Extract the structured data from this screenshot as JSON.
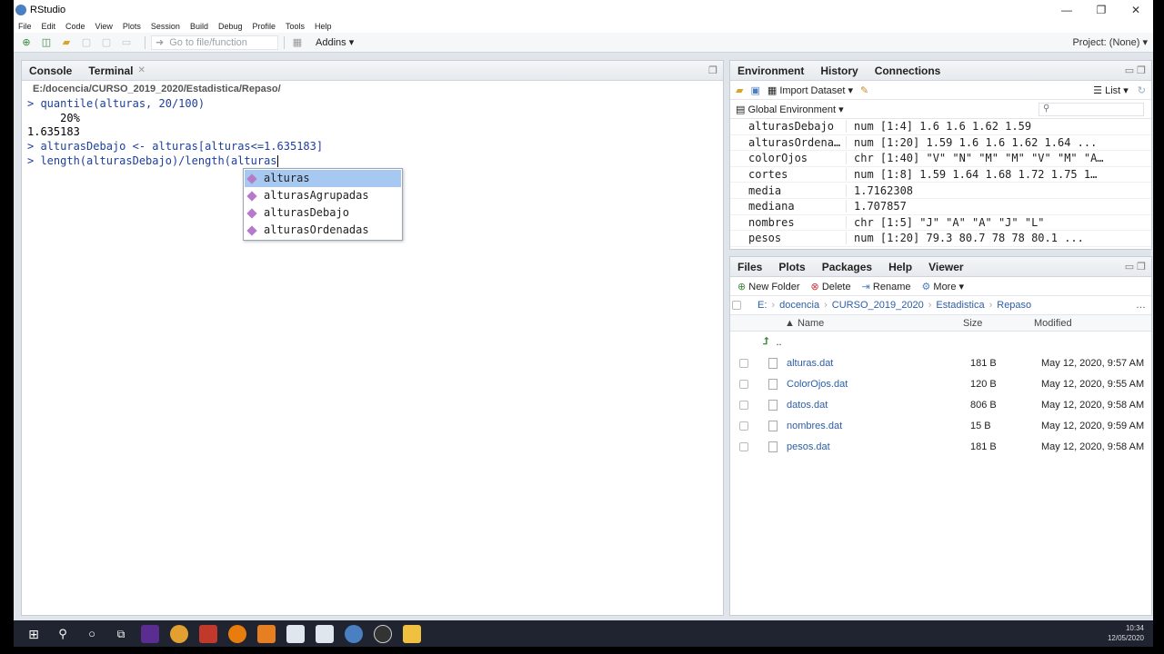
{
  "window": {
    "title": "RStudio",
    "controls": [
      "—",
      "❐",
      "✕"
    ]
  },
  "menu": [
    "File",
    "Edit",
    "Code",
    "View",
    "Plots",
    "Session",
    "Build",
    "Debug",
    "Profile",
    "Tools",
    "Help"
  ],
  "toolbar": {
    "goto_placeholder": "Go to file/function",
    "addins": "Addins",
    "project": "Project: (None)"
  },
  "console": {
    "tabs": [
      "Console",
      "Terminal"
    ],
    "path": "E:/docencia/CURSO_2019_2020/Estadistica/Repaso/",
    "lines": [
      {
        "type": "cmd",
        "text": "> quantile(alturas, 20/100)"
      },
      {
        "type": "out",
        "text": "     20%"
      },
      {
        "type": "out",
        "text": "1.635183"
      },
      {
        "type": "cmd",
        "text": "> alturasDebajo <- alturas[alturas<=1.635183]"
      },
      {
        "type": "cmd",
        "text": "> length(alturasDebajo)/length(alturas"
      }
    ],
    "autocomplete": [
      "alturas",
      "alturasAgrupadas",
      "alturasDebajo",
      "alturasOrdenadas"
    ]
  },
  "environment": {
    "tabs": [
      "Environment",
      "History",
      "Connections"
    ],
    "import_label": "Import Dataset",
    "list_label": "List",
    "scope": "Global Environment",
    "rows": [
      {
        "name": "alturasDebajo",
        "value": "num [1:4] 1.6 1.6 1.62 1.59"
      },
      {
        "name": "alturasOrdena…",
        "value": "num [1:20] 1.59 1.6 1.6 1.62 1.64 ..."
      },
      {
        "name": "colorOjos",
        "value": "chr [1:40] \"V\" \"N\" \"M\" \"M\" \"V\" \"M\" \"A…"
      },
      {
        "name": "cortes",
        "value": "num [1:8] 1.59 1.64 1.68 1.72 1.75 1…"
      },
      {
        "name": "media",
        "value": "1.7162308"
      },
      {
        "name": "mediana",
        "value": "1.707857"
      },
      {
        "name": "nombres",
        "value": "chr [1:5] \"J\" \"A\" \"A\" \"J\" \"L\""
      },
      {
        "name": "pesos",
        "value": "num [1:20] 79.3 80.7 78 78 80.1 ..."
      }
    ]
  },
  "files": {
    "tabs": [
      "Files",
      "Plots",
      "Packages",
      "Help",
      "Viewer"
    ],
    "tools": {
      "new_folder": "New Folder",
      "delete": "Delete",
      "rename": "Rename",
      "more": "More"
    },
    "breadcrumb": [
      "E:",
      "docencia",
      "CURSO_2019_2020",
      "Estadistica",
      "Repaso"
    ],
    "headers": {
      "name": "Name",
      "size": "Size",
      "modified": "Modified"
    },
    "parent": "..",
    "rows": [
      {
        "name": "alturas.dat",
        "size": "181 B",
        "modified": "May 12, 2020, 9:57 AM"
      },
      {
        "name": "ColorOjos.dat",
        "size": "120 B",
        "modified": "May 12, 2020, 9:55 AM"
      },
      {
        "name": "datos.dat",
        "size": "806 B",
        "modified": "May 12, 2020, 9:58 AM"
      },
      {
        "name": "nombres.dat",
        "size": "15 B",
        "modified": "May 12, 2020, 9:59 AM"
      },
      {
        "name": "pesos.dat",
        "size": "181 B",
        "modified": "May 12, 2020, 9:58 AM"
      }
    ]
  },
  "taskbar": {
    "time": "10:34",
    "date": "12/05/2020"
  }
}
